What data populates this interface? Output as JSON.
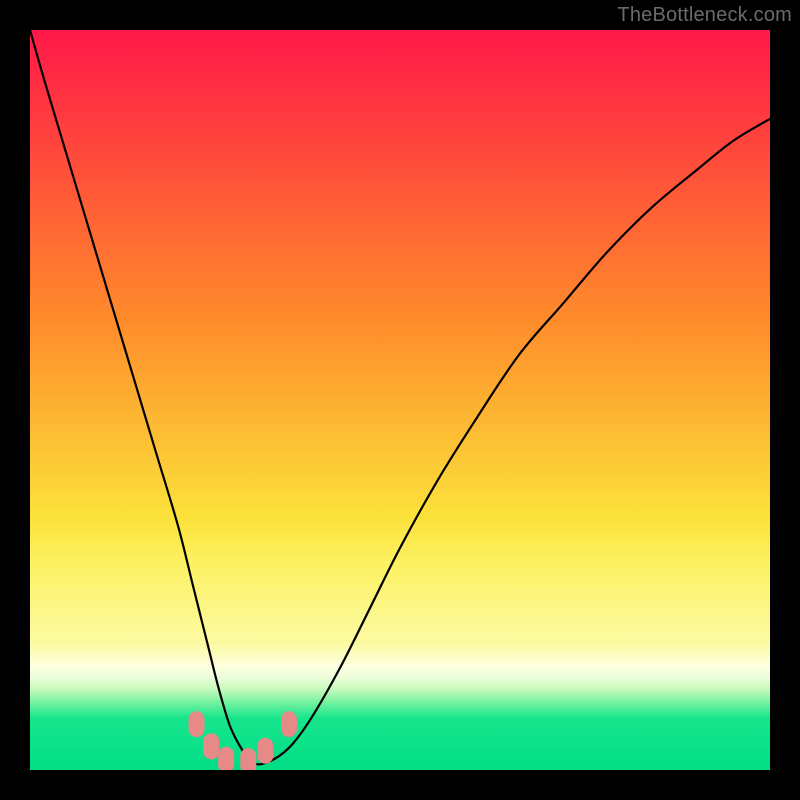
{
  "watermark": "TheBottleneck.com",
  "colors": {
    "black": "#000000",
    "curve": "#000000",
    "marker": "#e68a87",
    "gradient_top": "#ff1848",
    "gradient_orange": "#ff8b2b",
    "gradient_yellow_top": "#fbe23a",
    "gradient_yellow_mid": "#fdf162",
    "gradient_light_yellow": "#fcfba3",
    "gradient_band1": "#fdfee0",
    "gradient_band2": "#ecfedb",
    "gradient_band3": "#c9fbbd",
    "gradient_band4": "#85f4a5",
    "gradient_green": "#17e58c",
    "gradient_green_bottom": "#00de86"
  },
  "chart_data": {
    "type": "line",
    "title": "",
    "xlabel": "",
    "ylabel": "",
    "xlim": [
      0,
      100
    ],
    "ylim": [
      0,
      100
    ],
    "x": [
      0,
      2,
      5,
      8,
      11,
      14,
      17,
      20,
      22,
      24,
      25.5,
      27,
      28.5,
      30,
      32,
      35,
      38,
      42,
      46,
      50,
      55,
      60,
      66,
      72,
      78,
      84,
      90,
      95,
      100
    ],
    "y": [
      100,
      93,
      83,
      73,
      63,
      53,
      43,
      33,
      25,
      17,
      11,
      6,
      3,
      1,
      1,
      3,
      7,
      14,
      22,
      30,
      39,
      47,
      56,
      63,
      70,
      76,
      81,
      85,
      88
    ],
    "markers": {
      "x": [
        22.5,
        24.5,
        26.5,
        29.5,
        31.8,
        35.0
      ],
      "y": [
        6.2,
        3.2,
        1.4,
        1.2,
        2.6,
        6.2
      ]
    },
    "gradient_stops_pct": [
      0,
      39,
      66,
      72,
      83,
      86,
      87.5,
      89,
      90.5,
      93,
      100
    ],
    "annotations": []
  }
}
